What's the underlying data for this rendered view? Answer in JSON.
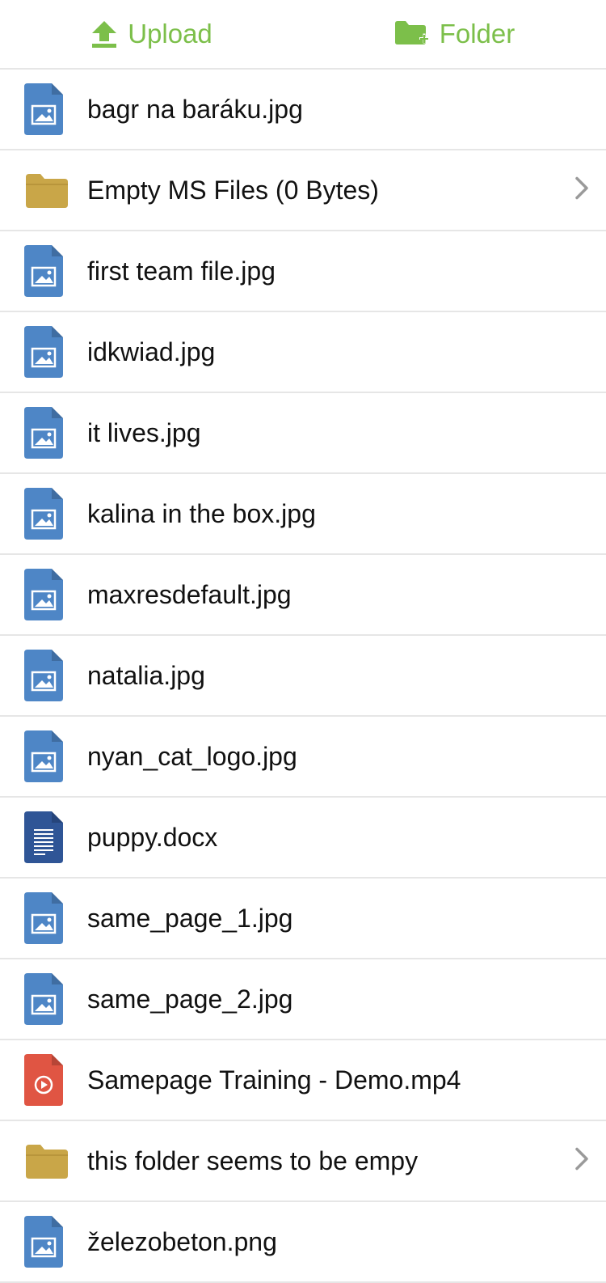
{
  "toolbar": {
    "upload_label": "Upload",
    "folder_label": "Folder",
    "accent_color": "#7cbf4a"
  },
  "files": [
    {
      "name": "bagr na baráku.jpg",
      "type": "image",
      "icon": "image-file-icon"
    },
    {
      "name": "Empty MS Files (0 Bytes)",
      "type": "folder",
      "icon": "folder-icon"
    },
    {
      "name": "first team file.jpg",
      "type": "image",
      "icon": "image-file-icon"
    },
    {
      "name": "idkwiad.jpg",
      "type": "image",
      "icon": "image-file-icon"
    },
    {
      "name": "it lives.jpg",
      "type": "image",
      "icon": "image-file-icon"
    },
    {
      "name": "kalina in the box.jpg",
      "type": "image",
      "icon": "image-file-icon"
    },
    {
      "name": "maxresdefault.jpg",
      "type": "image",
      "icon": "image-file-icon"
    },
    {
      "name": "natalia.jpg",
      "type": "image",
      "icon": "image-file-icon"
    },
    {
      "name": "nyan_cat_logo.jpg",
      "type": "image",
      "icon": "image-file-icon"
    },
    {
      "name": "puppy.docx",
      "type": "doc",
      "icon": "document-file-icon"
    },
    {
      "name": "same_page_1.jpg",
      "type": "image",
      "icon": "image-file-icon"
    },
    {
      "name": "same_page_2.jpg",
      "type": "image",
      "icon": "image-file-icon"
    },
    {
      "name": "Samepage Training - Demo.mp4",
      "type": "video",
      "icon": "video-file-icon"
    },
    {
      "name": "this folder seems to be empy",
      "type": "folder",
      "icon": "folder-icon"
    },
    {
      "name": "železobeton.png",
      "type": "image",
      "icon": "image-file-icon"
    }
  ],
  "colors": {
    "image": "#4e86c6",
    "doc": "#2f5596",
    "video": "#e05543",
    "folder": "#c9a648",
    "chevron": "#9a9a9a"
  }
}
